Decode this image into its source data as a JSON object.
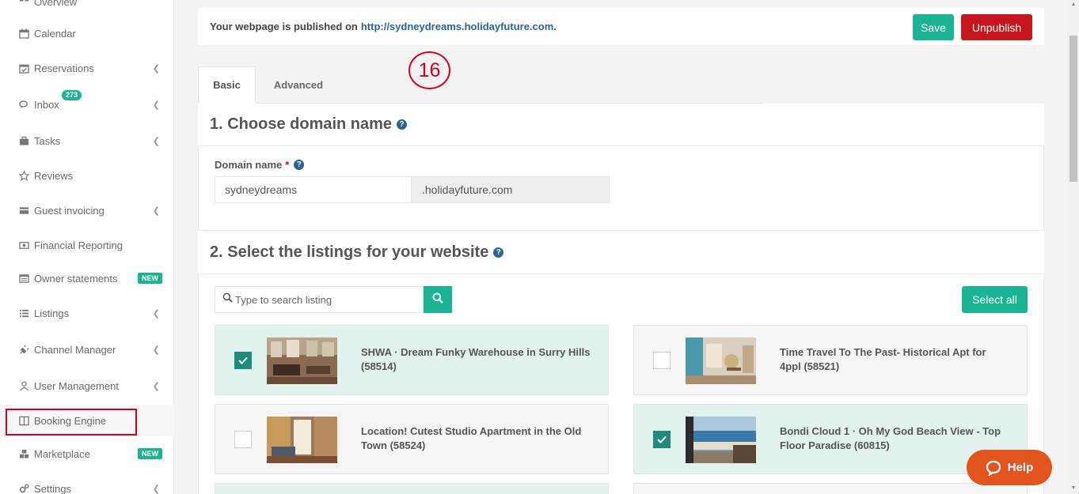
{
  "sidebar": {
    "items": [
      {
        "label": "Overview",
        "icon": "overview-icon"
      },
      {
        "label": "Calendar",
        "icon": "calendar-icon"
      },
      {
        "label": "Reservations",
        "icon": "calendar-check-icon"
      },
      {
        "label": "Inbox",
        "icon": "chat-icon",
        "badge": "273"
      },
      {
        "label": "Tasks",
        "icon": "briefcase-icon"
      },
      {
        "label": "Reviews",
        "icon": "star-icon"
      },
      {
        "label": "Guest invoicing",
        "icon": "card-icon"
      },
      {
        "label": "Financial Reporting",
        "icon": "money-icon"
      },
      {
        "label": "Owner statements",
        "icon": "list-icon",
        "badge": "NEW"
      },
      {
        "label": "Listings",
        "icon": "bullet-list-icon"
      },
      {
        "label": "Channel Manager",
        "icon": "plug-icon"
      },
      {
        "label": "User Management",
        "icon": "user-icon"
      },
      {
        "label": "Booking Engine",
        "icon": "columns-icon"
      },
      {
        "label": "Marketplace",
        "icon": "cubes-icon",
        "badge": "NEW"
      },
      {
        "label": "Settings",
        "icon": "gears-icon"
      }
    ]
  },
  "topbar": {
    "published_text": "Your webpage is published on",
    "published_url": "http://sydneydreams.holidayfuture.com.",
    "save_label": "Save",
    "unpublish_label": "Unpublish"
  },
  "annotation": {
    "number": "16"
  },
  "tabs": [
    {
      "label": "Basic",
      "active": true
    },
    {
      "label": "Advanced",
      "active": false
    }
  ],
  "section1": {
    "title": "1. Choose domain name",
    "field_label": "Domain name",
    "required_mark": "*",
    "domain_value": "sydneydreams",
    "domain_suffix": ".holidayfuture.com"
  },
  "section2": {
    "title": "2. Select the listings for your website",
    "search_placeholder": "Type to search listing",
    "select_all_label": "Select all",
    "listings": [
      {
        "title": "SHWA · Dream Funky Warehouse in Surry Hills (58514)",
        "checked": true
      },
      {
        "title": "Time Travel To The Past- Historical Apt for 4ppl (58521)",
        "checked": false
      },
      {
        "title": "Location! Cutest Studio Apartment in the Old Town (58524)",
        "checked": false
      },
      {
        "title": "Bondi Cloud 1 · Oh My God Beach View - Top Floor Paradise (60815)",
        "checked": true
      }
    ]
  },
  "help": {
    "label": "Help"
  },
  "colors": {
    "accent": "#1ab394",
    "danger": "#c4161c",
    "help": "#e2551f",
    "link": "#2a6496"
  }
}
